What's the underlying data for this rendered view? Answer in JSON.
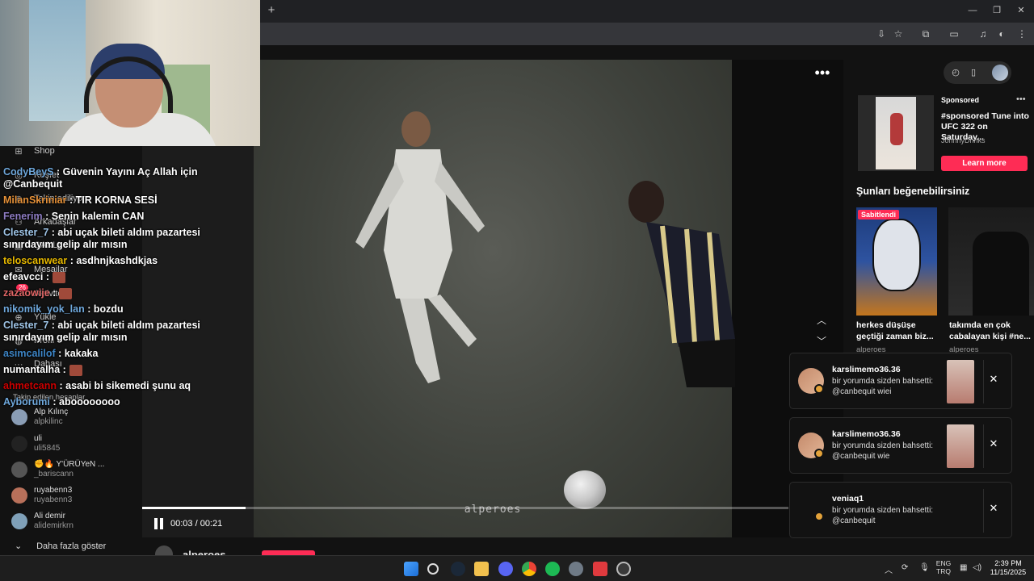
{
  "colors": {
    "accent": "#fe2c55",
    "bg": "#121212"
  },
  "sidebar": {
    "items": [
      {
        "label": "Shop",
        "icon": "shop-icon"
      },
      {
        "label": "Keşfet",
        "icon": "compass-icon"
      },
      {
        "label": "Takip ediliyor",
        "icon": "following-icon"
      },
      {
        "label": "Arkadaşlar",
        "icon": "friends-icon"
      },
      {
        "label": "CANLI",
        "icon": "live-icon"
      },
      {
        "label": "Mesajlar",
        "icon": "messages-icon"
      },
      {
        "label": "Aktivite",
        "icon": "activity-icon",
        "badge": "26"
      },
      {
        "label": "Yükle",
        "icon": "upload-icon"
      },
      {
        "label": "Profil",
        "icon": "profile-icon"
      },
      {
        "label": "Dahası",
        "icon": "more-icon"
      }
    ],
    "followed_header": "Takip edilen hesaplar",
    "accounts": [
      {
        "name": "Alp Kılınç",
        "user": "alpkilinc"
      },
      {
        "name": "uli",
        "user": "uli5845"
      },
      {
        "name": "✊🔥 Y'ÜRÜYeN ...",
        "user": "_bariscann"
      },
      {
        "name": "ruyabenn3",
        "user": "ruyabenn3"
      },
      {
        "name": "Ali demir",
        "user": "alidemirkrn"
      }
    ],
    "see_more": "Daha fazla göster"
  },
  "chat": [
    {
      "user": "CodyBeyS",
      "color": "#6fa8dc",
      "text": ": Güvenin Yayını Aç Allah için @Canbequit"
    },
    {
      "user": "MilanSkriniar",
      "color": "#e69138",
      "text": ": TIR KORNA SESİ"
    },
    {
      "user": "Fenerim",
      "color": "#8e7cc3",
      "text": ": Senin kalemin CAN"
    },
    {
      "user": "Clester_7",
      "color": "#9fc5e8",
      "text": ": abi uçak bileti aldım pazartesi sınırdayım gelip alır mısın"
    },
    {
      "user": "teloscanwear",
      "color": "#e6b800",
      "text": ": asdhnjkashdkjas"
    },
    {
      "user": "efeavcci",
      "color": "#ffffff",
      "text": ":",
      "emote": true
    },
    {
      "user": "zazaowije",
      "color": "#e06666",
      "text": ":",
      "emote": true
    },
    {
      "user": "nikomik_yok_lan",
      "color": "#6fa8dc",
      "text": ": bozdu"
    },
    {
      "user": "Clester_7",
      "color": "#9fc5e8",
      "text": ": abi uçak bileti aldım pazartesi sınırdayım gelip alır mısın"
    },
    {
      "user": "asimcalilof",
      "color": "#3d85c6",
      "text": ": kakaka"
    },
    {
      "user": "numantalha",
      "color": "#ffffff",
      "text": ":",
      "emote": true
    },
    {
      "user": "ahmetcann",
      "color": "#cc0000",
      "text": ": asabi bi sikemedi şunu aq"
    },
    {
      "user": "Ayborumi",
      "color": "#6fa8dc",
      "text": ": aboooooooo"
    }
  ],
  "video": {
    "watermark": "alperoes",
    "time": "00:03 / 00:21",
    "progress": 0.16,
    "author": "alperoes"
  },
  "ad": {
    "label": "Sponsored",
    "title": "#sponsored Tune into UFC 322 on Saturday...",
    "brand": "JohnnyDrinks",
    "cta": "Learn more"
  },
  "suggestions": {
    "title": "Şunları beğenebilirsiniz",
    "cards": [
      {
        "pinned": "Sabitlendi",
        "caption": "herkes düşüşe geçtiği zaman biz...",
        "author": "alperoes"
      },
      {
        "caption": "takımda en çok cabalayan kişi #ne...",
        "author": "alperoes"
      }
    ]
  },
  "notifications": [
    {
      "user": "karslimemo36.36",
      "text": "bir yorumda sizden bahsetti: @canbequit wiei"
    },
    {
      "user": "karslimemo36.36",
      "text": "bir yorumda sizden bahsetti: @canbequit wie"
    },
    {
      "user": "veniaq1",
      "text": "bir yorumda sizden bahsetti: @canbequit"
    }
  ],
  "taskbar": {
    "apps": [
      "windows-start-icon",
      "search-icon",
      "steam-icon",
      "folder-icon",
      "app-icon",
      "chrome-icon",
      "spotify-icon",
      "settings-icon",
      "video-app-icon",
      "game-icon"
    ],
    "lang_top": "ENG",
    "lang_bottom": "TRQ",
    "time": "2:39 PM",
    "date": "11/15/2025"
  }
}
